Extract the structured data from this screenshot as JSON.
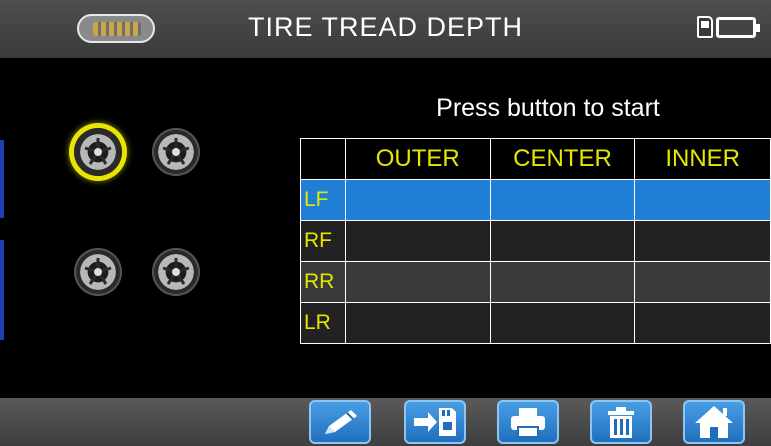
{
  "header": {
    "title": "TIRE TREAD DEPTH",
    "logo_icon": "vehicle-tool-logo",
    "sd_card_icon": "sd-card-icon",
    "battery_icon": "battery-icon"
  },
  "instruction": "Press button to start",
  "tires": [
    {
      "position": "LF",
      "selected": true
    },
    {
      "position": "RF",
      "selected": false
    },
    {
      "position": "LR",
      "selected": false
    },
    {
      "position": "RR",
      "selected": false
    }
  ],
  "table": {
    "columns": [
      "OUTER",
      "CENTER",
      "INNER"
    ],
    "rows": [
      {
        "label": "LF",
        "values": [
          "",
          "",
          ""
        ],
        "highlighted": true
      },
      {
        "label": "RF",
        "values": [
          "",
          "",
          ""
        ]
      },
      {
        "label": "RR",
        "values": [
          "",
          "",
          ""
        ]
      },
      {
        "label": "LR",
        "values": [
          "",
          "",
          ""
        ]
      }
    ]
  },
  "footer": {
    "buttons": [
      "edit-pencil-icon",
      "save-to-card-icon",
      "print-icon",
      "trash-icon",
      "home-icon"
    ]
  },
  "colors": {
    "accent": "#e6e600",
    "highlight_row": "#1f7fd6",
    "button": "#2f86d6"
  }
}
